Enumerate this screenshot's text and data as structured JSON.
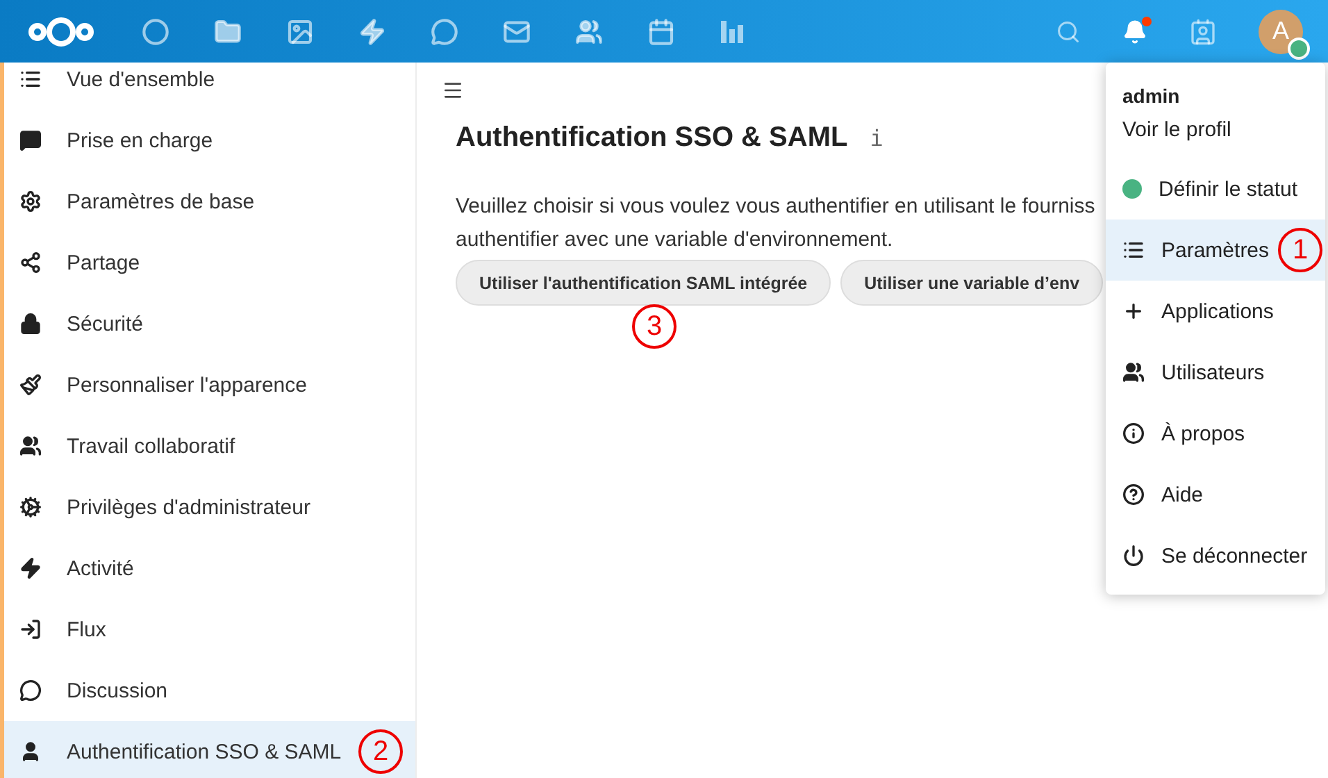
{
  "header": {
    "apps": [
      {
        "kind": "dashboard"
      },
      {
        "kind": "files"
      },
      {
        "kind": "photos"
      },
      {
        "kind": "activity"
      },
      {
        "kind": "talk"
      },
      {
        "kind": "mail"
      },
      {
        "kind": "contacts"
      },
      {
        "kind": "calendar"
      },
      {
        "kind": "stats"
      }
    ],
    "notifications_unread": true,
    "avatar": {
      "letter": "A",
      "online": true
    }
  },
  "sidebar": {
    "items": [
      {
        "label": "Vue d'ensemble",
        "kind": "overview",
        "selected": false
      },
      {
        "label": "Prise en charge",
        "kind": "support",
        "selected": false
      },
      {
        "label": "Paramètres de base",
        "kind": "basic",
        "selected": false
      },
      {
        "label": "Partage",
        "kind": "sharing",
        "selected": false
      },
      {
        "label": "Sécurité",
        "kind": "security",
        "selected": false
      },
      {
        "label": "Personnaliser l'apparence",
        "kind": "theming",
        "selected": false
      },
      {
        "label": "Travail collaboratif",
        "kind": "groupware",
        "selected": false
      },
      {
        "label": "Privilèges d'administrateur",
        "kind": "privileges",
        "selected": false
      },
      {
        "label": "Activité",
        "kind": "activity",
        "selected": false
      },
      {
        "label": "Flux",
        "kind": "flow",
        "selected": false
      },
      {
        "label": "Discussion",
        "kind": "talk",
        "selected": false
      },
      {
        "label": "Authentification SSO & SAML",
        "kind": "sso",
        "selected": true
      }
    ]
  },
  "content": {
    "title": "Authentification SSO & SAML",
    "info": "i",
    "description_lines": [
      "Veuillez choisir si vous voulez vous authentifier en utilisant le fourniss",
      "authentifier avec une variable d'environnement."
    ],
    "buttons": [
      "Utiliser l'authentification SAML intégrée",
      "Utiliser une variable d’env"
    ]
  },
  "user_menu": {
    "user": "admin",
    "profile_link": "Voir le profil",
    "items": [
      {
        "label": "Définir le statut",
        "kind": "status",
        "selected": false
      },
      {
        "label": "Paramètres",
        "kind": "settings",
        "selected": true
      },
      {
        "label": "Applications",
        "kind": "apps",
        "selected": false
      },
      {
        "label": "Utilisateurs",
        "kind": "users",
        "selected": false
      },
      {
        "label": "À propos",
        "kind": "about",
        "selected": false
      },
      {
        "label": "Aide",
        "kind": "help",
        "selected": false
      },
      {
        "label": "Se déconnecter",
        "kind": "logout",
        "selected": false
      }
    ]
  },
  "callouts": [
    {
      "label": "1"
    },
    {
      "label": "2"
    },
    {
      "label": "3"
    }
  ]
}
